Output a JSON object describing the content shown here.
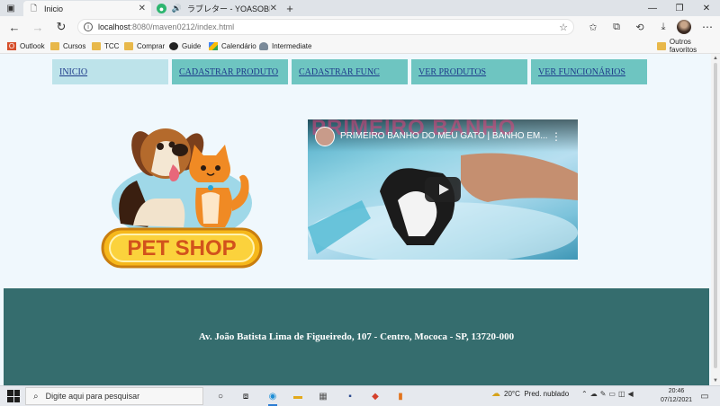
{
  "browser": {
    "tabs": [
      {
        "title": "Inicio",
        "active": true
      },
      {
        "title": "ラブレター - YOASOBI",
        "active": false
      }
    ],
    "address": {
      "host": "localhost",
      "path": ":8080/maven0212/index.html"
    },
    "bookmarks": [
      {
        "label": "Outlook",
        "icon": "outlook-icon"
      },
      {
        "label": "Cursos",
        "icon": "folder-icon"
      },
      {
        "label": "TCC",
        "icon": "folder-icon"
      },
      {
        "label": "Comprar",
        "icon": "folder-icon"
      },
      {
        "label": "Guide",
        "icon": "github-icon"
      },
      {
        "label": "Calendário",
        "icon": "calendar-icon"
      },
      {
        "label": "Intermediate",
        "icon": "ghost-icon"
      },
      {
        "label": "Outros favoritos",
        "icon": "folder-icon"
      }
    ]
  },
  "nav": {
    "items": [
      {
        "label": "INICIO",
        "active": true
      },
      {
        "label": "CADASTRAR PRODUTO",
        "active": false
      },
      {
        "label": "CADASTRAR FUNC",
        "active": false
      },
      {
        "label": "VER PRODUTOS",
        "active": false
      },
      {
        "label": "VER FUNCIONÁRIOS",
        "active": false
      }
    ]
  },
  "logo": {
    "text": "PET SHOP"
  },
  "video": {
    "title": "PRIMEIRO BANHO DO MEU GATO | BANHO EM...",
    "banner": "PRIMEIRO BANHO"
  },
  "footer": {
    "address": "Av. João Batista Lima de Figueiredo, 107 - Centro, Mococa - SP, 13720-000"
  },
  "taskbar": {
    "search_placeholder": "Digite aqui para pesquisar",
    "weather": {
      "temp": "20°C",
      "condition": "Pred. nublado"
    },
    "clock": {
      "time": "20:46",
      "date": "07/12/2021"
    }
  },
  "colors": {
    "nav_bg": "#6ec5c1",
    "nav_active_bg": "#bde3ea",
    "nav_link": "#1e3a8a",
    "page_bg": "#f0f8fd",
    "footer_bg": "#356d6e"
  }
}
